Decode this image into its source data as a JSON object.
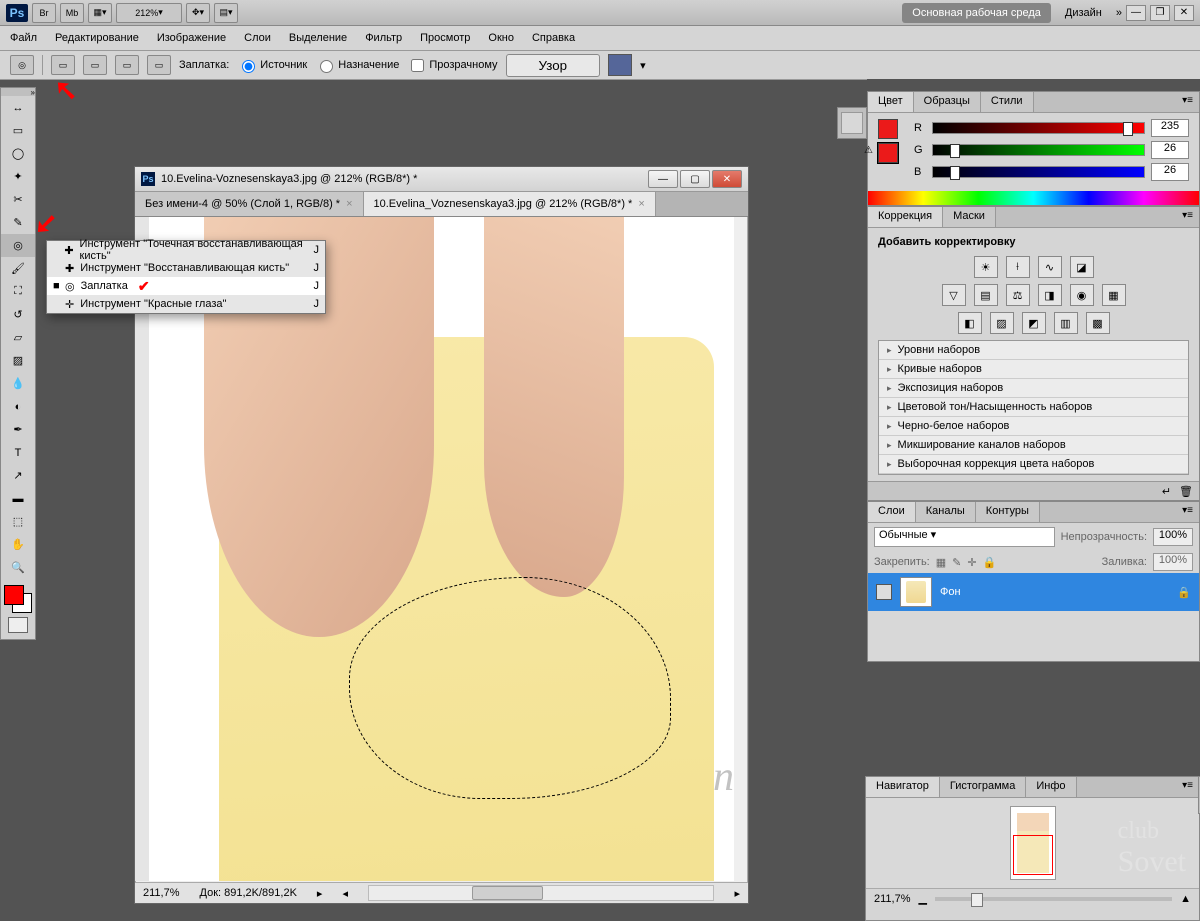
{
  "titlebar": {
    "zoom": "212%",
    "workspace": "Основная рабочая среда",
    "design": "Дизайн"
  },
  "menubar": [
    "Файл",
    "Редактирование",
    "Изображение",
    "Слои",
    "Выделение",
    "Фильтр",
    "Просмотр",
    "Окно",
    "Справка"
  ],
  "options": {
    "patch_label": "Заплатка:",
    "source": "Источник",
    "destination": "Назначение",
    "transparent": "Прозрачному",
    "pattern_btn": "Узор"
  },
  "flyout": {
    "items": [
      {
        "label": "Инструмент \"Точечная восстанавливающая кисть\"",
        "key": "J"
      },
      {
        "label": "Инструмент \"Восстанавливающая кисть\"",
        "key": "J"
      },
      {
        "label": "Заплатка",
        "key": "J",
        "selected": true
      },
      {
        "label": "Инструмент \"Красные глаза\"",
        "key": "J"
      }
    ]
  },
  "doc": {
    "title": "10.Evelina-Voznesenskaya3.jpg @ 212% (RGB/8*) *",
    "tabs": [
      {
        "label": "Без имени-4 @ 50% (Слой 1, RGB/8) *"
      },
      {
        "label": "10.Evelina_Voznesenskaya3.jpg @ 212% (RGB/8*) *",
        "active": true
      }
    ],
    "status_zoom": "211,7%",
    "status_doc": "Док: 891,2K/891,2K"
  },
  "color_panel": {
    "tabs": [
      "Цвет",
      "Образцы",
      "Стили"
    ],
    "R": 235,
    "G": 26,
    "B": 26
  },
  "adjust_panel": {
    "tabs": [
      "Коррекция",
      "Маски"
    ],
    "add_label": "Добавить корректировку",
    "presets": [
      "Уровни наборов",
      "Кривые наборов",
      "Экспозиция наборов",
      "Цветовой тон/Насыщенность наборов",
      "Черно-белое наборов",
      "Микширование каналов наборов",
      "Выборочная коррекция цвета наборов"
    ]
  },
  "layers_panel": {
    "tabs": [
      "Слои",
      "Каналы",
      "Контуры"
    ],
    "blend": "Обычные",
    "opacity_label": "Непрозрачность:",
    "opacity": "100%",
    "lock_label": "Закрепить:",
    "fill_label": "Заливка:",
    "fill": "100%",
    "layer_name": "Фон"
  },
  "nav_panel": {
    "tabs": [
      "Навигатор",
      "Гистограмма",
      "Инфо"
    ],
    "zoom": "211,7%"
  }
}
